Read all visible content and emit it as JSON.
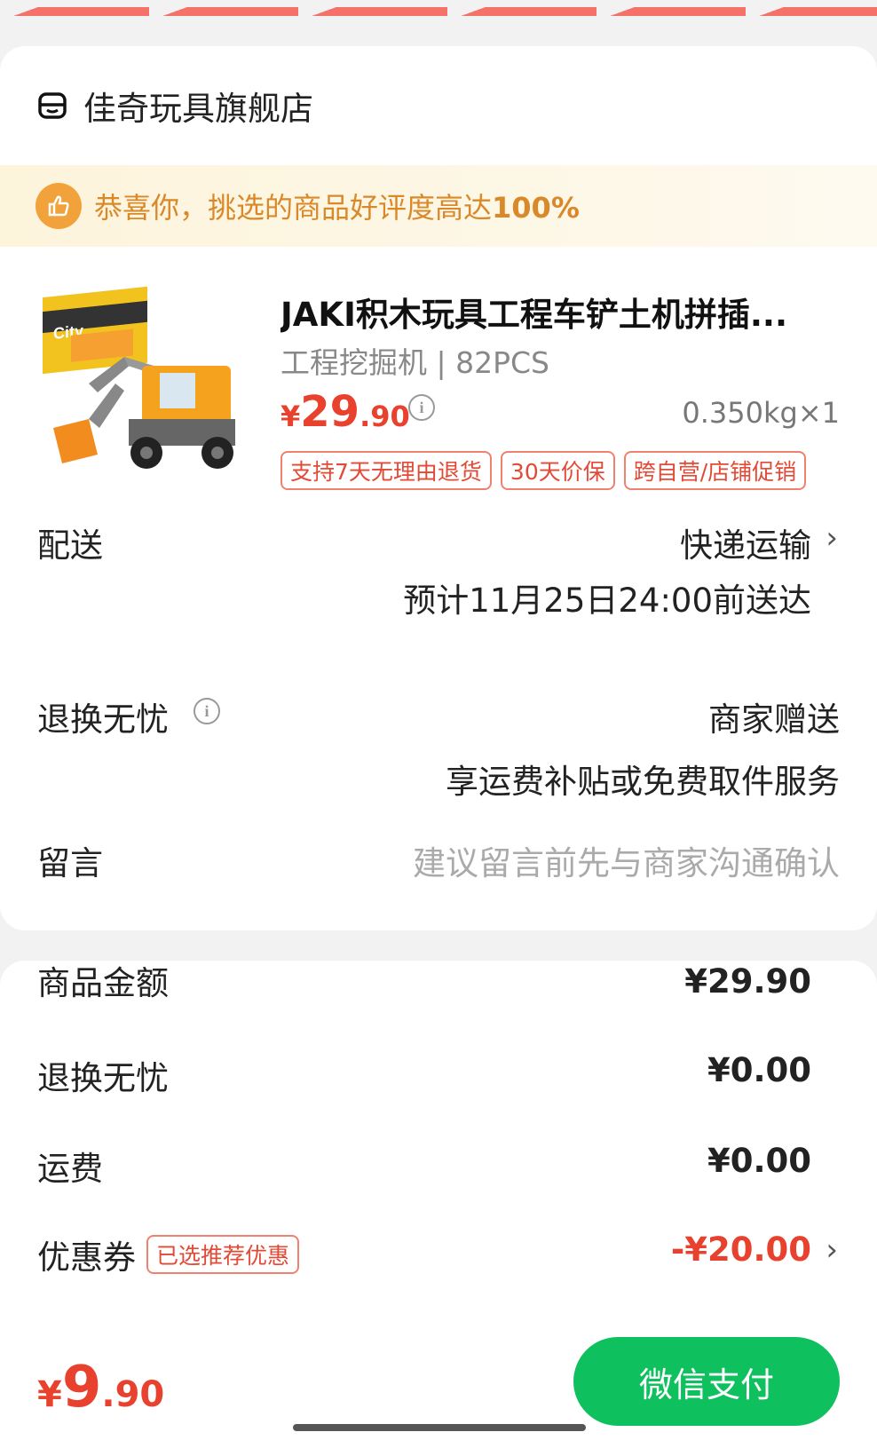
{
  "shop": {
    "name": "佳奇玩具旗舰店"
  },
  "banner": {
    "text": "恭喜你，挑选的商品好评度高达",
    "highlight": "100%"
  },
  "product": {
    "title": "JAKI积木玩具工程车铲土机拼插...",
    "spec": "工程挖掘机 | 82PCS",
    "price_symbol": "¥",
    "price_int": "29",
    "price_dec": ".90",
    "weight": "0.350kg×1",
    "tags": [
      "支持7天无理由退货",
      "30天价保",
      "跨自营/店铺促销"
    ]
  },
  "delivery": {
    "label": "配送",
    "method": "快递运输",
    "eta": "预计11月25日24:00前送达"
  },
  "returns": {
    "label": "退换无忧",
    "value": "商家赠送",
    "note": "享运费补贴或免费取件服务"
  },
  "message": {
    "label": "留言",
    "placeholder": "建议留言前先与商家沟通确认"
  },
  "summary": {
    "goods_label": "商品金额",
    "goods_value": "¥29.90",
    "returns_label": "退换无忧",
    "returns_value": "¥0.00",
    "shipping_label": "运费",
    "shipping_value": "¥0.00",
    "coupon_label": "优惠券",
    "coupon_tag": "已选推荐优惠",
    "coupon_value": "-¥20.00"
  },
  "footer": {
    "total_symbol": "¥",
    "total_int": "9",
    "total_dec": ".90",
    "pay_label": "微信支付"
  },
  "colors": {
    "price": "#e8412e",
    "pay": "#0fc15e",
    "banner_text": "#d9892a"
  }
}
